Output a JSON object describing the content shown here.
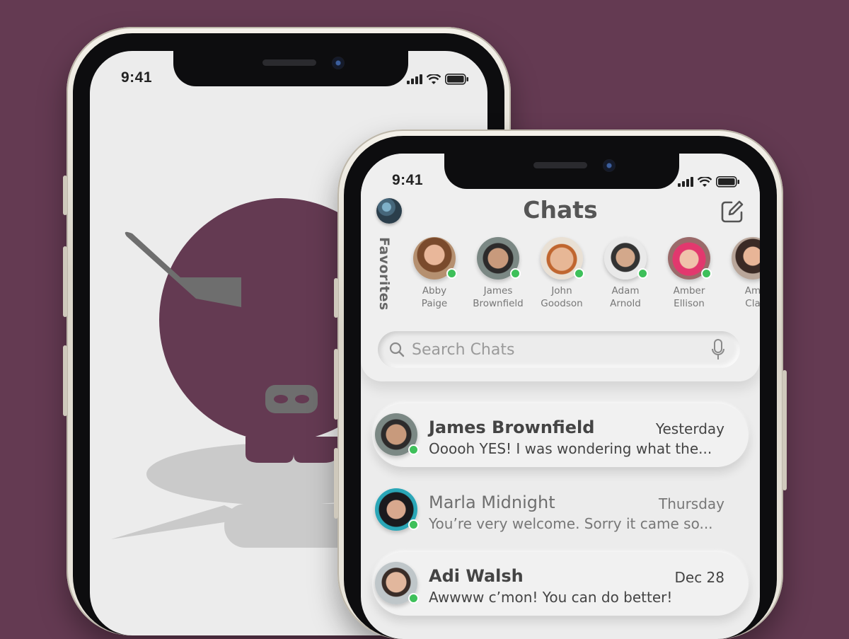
{
  "back_phone": {
    "status_time": "9:41"
  },
  "front_phone": {
    "status_time": "9:41",
    "header": {
      "title": "Chats",
      "compose_icon": "compose-edit-icon",
      "profile_icon": "user-avatar"
    },
    "favorites": {
      "label": "Favorites",
      "people": [
        {
          "first": "Abby",
          "last": "Paige",
          "online": true
        },
        {
          "first": "James",
          "last": "Brownfield",
          "online": true
        },
        {
          "first": "John",
          "last": "Goodson",
          "online": true
        },
        {
          "first": "Adam",
          "last": "Arnold",
          "online": true
        },
        {
          "first": "Amber",
          "last": "Ellison",
          "online": true
        },
        {
          "first": "Am",
          "last": "Cla",
          "online": false
        }
      ]
    },
    "search": {
      "placeholder": "Search Chats",
      "search_icon": "search-icon",
      "mic_icon": "microphone-icon"
    },
    "chats": [
      {
        "name": "James Brownfield",
        "time": "Yesterday",
        "message": "Ooooh YES! I was wondering what the...",
        "online": true,
        "unread": true
      },
      {
        "name": "Marla Midnight",
        "time": "Thursday",
        "message": "You’re very welcome. Sorry it came so...",
        "online": true,
        "unread": false
      },
      {
        "name": "Adi Walsh",
        "time": "Dec 28",
        "message": "Awwww c’mon! You can do better!",
        "online": true,
        "unread": true
      }
    ]
  },
  "colors": {
    "background": "#643a52",
    "brand": "#643a52",
    "online": "#3ec05a",
    "screen": "#ececec"
  }
}
